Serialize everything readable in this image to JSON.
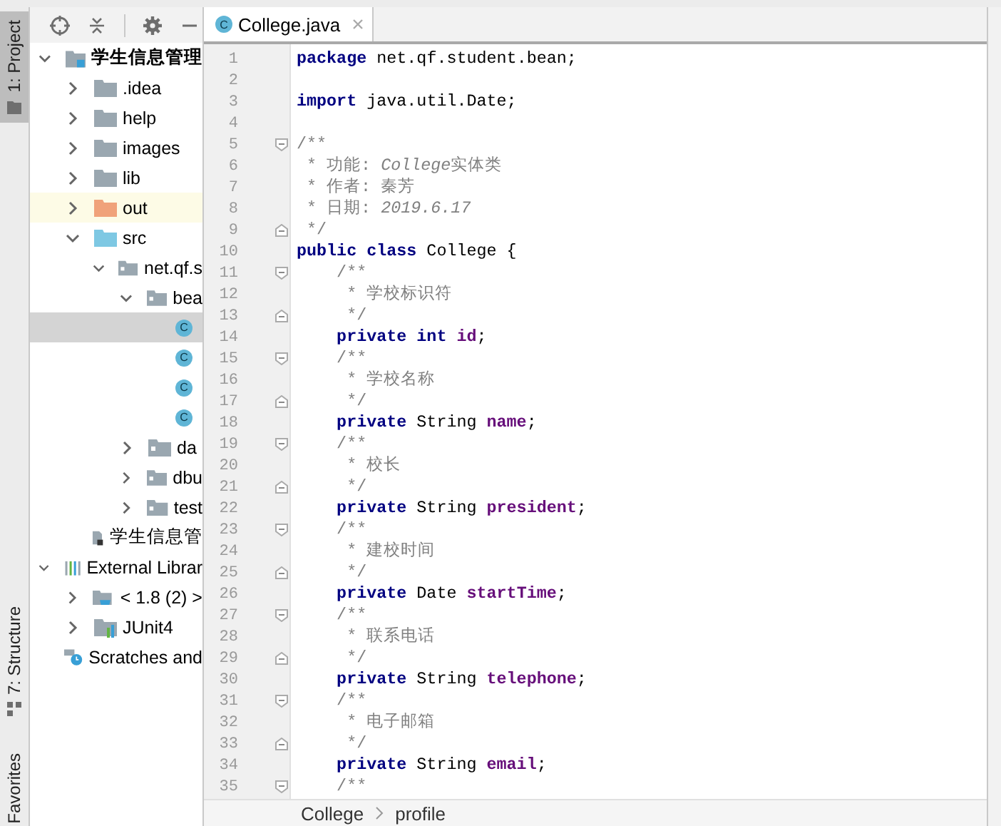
{
  "tool_strip": {
    "tabs": [
      {
        "label": "1: Project",
        "kind": "project",
        "selected": true
      },
      {
        "label": "7: Structure",
        "kind": "structure",
        "selected": false
      },
      {
        "label": "Favorites",
        "kind": "favorites",
        "selected": false
      }
    ]
  },
  "project_panel": {
    "tree": [
      {
        "label": "学生信息管理",
        "kind": "module",
        "bold": true,
        "expanded": true,
        "selected": false,
        "children": [
          {
            "label": ".idea",
            "kind": "folder",
            "expanded": false,
            "selected": false
          },
          {
            "label": "help",
            "kind": "folder",
            "expanded": false,
            "selected": false
          },
          {
            "label": "images",
            "kind": "folder",
            "expanded": false,
            "selected": false
          },
          {
            "label": "lib",
            "kind": "folder",
            "expanded": false,
            "selected": false
          },
          {
            "label": "out",
            "kind": "excluded-folder",
            "expanded": false,
            "selected": false
          },
          {
            "label": "src",
            "kind": "source-folder",
            "expanded": true,
            "selected": false,
            "children": [
              {
                "label": "net.qf.s",
                "kind": "package",
                "expanded": true,
                "selected": false,
                "children": [
                  {
                    "label": "bea",
                    "kind": "package",
                    "expanded": true,
                    "selected": false,
                    "children": [
                      {
                        "kind": "class",
                        "icon_letter": "C",
                        "selected": true
                      },
                      {
                        "kind": "class",
                        "icon_letter": "C",
                        "selected": false
                      },
                      {
                        "kind": "class",
                        "icon_letter": "C",
                        "selected": false
                      },
                      {
                        "kind": "class",
                        "icon_letter": "C",
                        "selected": false
                      }
                    ]
                  },
                  {
                    "label": "da",
                    "kind": "package",
                    "expanded": false,
                    "selected": false
                  },
                  {
                    "label": "dbu",
                    "kind": "package",
                    "expanded": false,
                    "selected": false
                  },
                  {
                    "label": "test",
                    "kind": "package",
                    "expanded": false,
                    "selected": false
                  }
                ]
              }
            ]
          },
          {
            "label": "学生信息管",
            "kind": "module-file",
            "selected": false
          }
        ]
      },
      {
        "label": "External Librar",
        "kind": "libraries",
        "expanded": true,
        "selected": false,
        "children": [
          {
            "label": "< 1.8 (2) >",
            "kind": "jdk",
            "expanded": false,
            "selected": false
          },
          {
            "label": "JUnit4",
            "kind": "library",
            "expanded": false,
            "selected": false
          }
        ]
      },
      {
        "label": "Scratches and",
        "kind": "scratches",
        "selected": false
      }
    ]
  },
  "editor": {
    "tabs": [
      {
        "label": "College.java",
        "icon_letter": "C",
        "selected": true
      }
    ],
    "lines": [
      {
        "number": "1",
        "kind": "code",
        "segments": [
          {
            "kind": "keyword",
            "text": "package"
          },
          {
            "kind": "plain",
            "text": " net.qf.student.bean;"
          }
        ]
      },
      {
        "number": "2",
        "kind": "code"
      },
      {
        "number": "3",
        "kind": "code",
        "segments": [
          {
            "kind": "keyword",
            "text": "import"
          },
          {
            "kind": "plain",
            "text": " java.util.Date;"
          }
        ]
      },
      {
        "number": "4",
        "kind": "code"
      },
      {
        "number": "5",
        "kind": "fold-start",
        "segments": [
          {
            "kind": "comment",
            "text": "/**"
          }
        ]
      },
      {
        "number": "6",
        "kind": "code",
        "segments": [
          {
            "kind": "comment",
            "text": " * 功能: "
          },
          {
            "kind": "comment-italic",
            "text": "College"
          },
          {
            "kind": "comment",
            "text": "实体类"
          }
        ]
      },
      {
        "number": "7",
        "kind": "code",
        "segments": [
          {
            "kind": "comment",
            "text": " * 作者: 秦芳"
          }
        ]
      },
      {
        "number": "8",
        "kind": "code",
        "segments": [
          {
            "kind": "comment",
            "text": " * 日期: "
          },
          {
            "kind": "comment-italic",
            "text": "2019.6.17"
          }
        ]
      },
      {
        "number": "9",
        "kind": "fold-end",
        "segments": [
          {
            "kind": "comment",
            "text": " */"
          }
        ]
      },
      {
        "number": "10",
        "kind": "code",
        "segments": [
          {
            "kind": "keyword",
            "text": "public class"
          },
          {
            "kind": "plain",
            "text": " College {"
          }
        ]
      },
      {
        "number": "11",
        "kind": "fold-start",
        "segments": [
          {
            "kind": "comment",
            "text": "    /**"
          }
        ]
      },
      {
        "number": "12",
        "kind": "code",
        "segments": [
          {
            "kind": "comment",
            "text": "     * 学校标识符"
          }
        ]
      },
      {
        "number": "13",
        "kind": "fold-end",
        "segments": [
          {
            "kind": "comment",
            "text": "     */"
          }
        ]
      },
      {
        "number": "14",
        "kind": "code",
        "segments": [
          {
            "kind": "keyword",
            "text": "    private int "
          },
          {
            "kind": "field",
            "text": "id"
          },
          {
            "kind": "plain",
            "text": ";"
          }
        ]
      },
      {
        "number": "15",
        "kind": "fold-start",
        "segments": [
          {
            "kind": "comment",
            "text": "    /**"
          }
        ]
      },
      {
        "number": "16",
        "kind": "code",
        "segments": [
          {
            "kind": "comment",
            "text": "     * 学校名称"
          }
        ]
      },
      {
        "number": "17",
        "kind": "fold-end",
        "segments": [
          {
            "kind": "comment",
            "text": "     */"
          }
        ]
      },
      {
        "number": "18",
        "kind": "code",
        "segments": [
          {
            "kind": "keyword",
            "text": "    private"
          },
          {
            "kind": "plain",
            "text": " String "
          },
          {
            "kind": "field",
            "text": "name"
          },
          {
            "kind": "plain",
            "text": ";"
          }
        ]
      },
      {
        "number": "19",
        "kind": "fold-start",
        "segments": [
          {
            "kind": "comment",
            "text": "    /**"
          }
        ]
      },
      {
        "number": "20",
        "kind": "code",
        "segments": [
          {
            "kind": "comment",
            "text": "     * 校长"
          }
        ]
      },
      {
        "number": "21",
        "kind": "fold-end",
        "segments": [
          {
            "kind": "comment",
            "text": "     */"
          }
        ]
      },
      {
        "number": "22",
        "kind": "code",
        "segments": [
          {
            "kind": "keyword",
            "text": "    private"
          },
          {
            "kind": "plain",
            "text": " String "
          },
          {
            "kind": "field",
            "text": "president"
          },
          {
            "kind": "plain",
            "text": ";"
          }
        ]
      },
      {
        "number": "23",
        "kind": "fold-start",
        "segments": [
          {
            "kind": "comment",
            "text": "    /**"
          }
        ]
      },
      {
        "number": "24",
        "kind": "code",
        "segments": [
          {
            "kind": "comment",
            "text": "     * 建校时间"
          }
        ]
      },
      {
        "number": "25",
        "kind": "fold-end",
        "segments": [
          {
            "kind": "comment",
            "text": "     */"
          }
        ]
      },
      {
        "number": "26",
        "kind": "code",
        "segments": [
          {
            "kind": "keyword",
            "text": "    private"
          },
          {
            "kind": "plain",
            "text": " Date "
          },
          {
            "kind": "field",
            "text": "startTime"
          },
          {
            "kind": "plain",
            "text": ";"
          }
        ]
      },
      {
        "number": "27",
        "kind": "fold-start",
        "segments": [
          {
            "kind": "comment",
            "text": "    /**"
          }
        ]
      },
      {
        "number": "28",
        "kind": "code",
        "segments": [
          {
            "kind": "comment",
            "text": "     * 联系电话"
          }
        ]
      },
      {
        "number": "29",
        "kind": "fold-end",
        "segments": [
          {
            "kind": "comment",
            "text": "     */"
          }
        ]
      },
      {
        "number": "30",
        "kind": "code",
        "segments": [
          {
            "kind": "keyword",
            "text": "    private"
          },
          {
            "kind": "plain",
            "text": " String "
          },
          {
            "kind": "field",
            "text": "telephone"
          },
          {
            "kind": "plain",
            "text": ";"
          }
        ]
      },
      {
        "number": "31",
        "kind": "fold-start",
        "segments": [
          {
            "kind": "comment",
            "text": "    /**"
          }
        ]
      },
      {
        "number": "32",
        "kind": "code",
        "segments": [
          {
            "kind": "comment",
            "text": "     * 电子邮箱"
          }
        ]
      },
      {
        "number": "33",
        "kind": "fold-end",
        "segments": [
          {
            "kind": "comment",
            "text": "     */"
          }
        ]
      },
      {
        "number": "34",
        "kind": "code",
        "segments": [
          {
            "kind": "keyword",
            "text": "    private"
          },
          {
            "kind": "plain",
            "text": " String "
          },
          {
            "kind": "field",
            "text": "email"
          },
          {
            "kind": "plain",
            "text": ";"
          }
        ]
      },
      {
        "number": "35",
        "kind": "fold-start",
        "segments": [
          {
            "kind": "comment",
            "text": "    /**"
          }
        ]
      }
    ],
    "breadcrumb": [
      "College",
      "profile"
    ]
  }
}
